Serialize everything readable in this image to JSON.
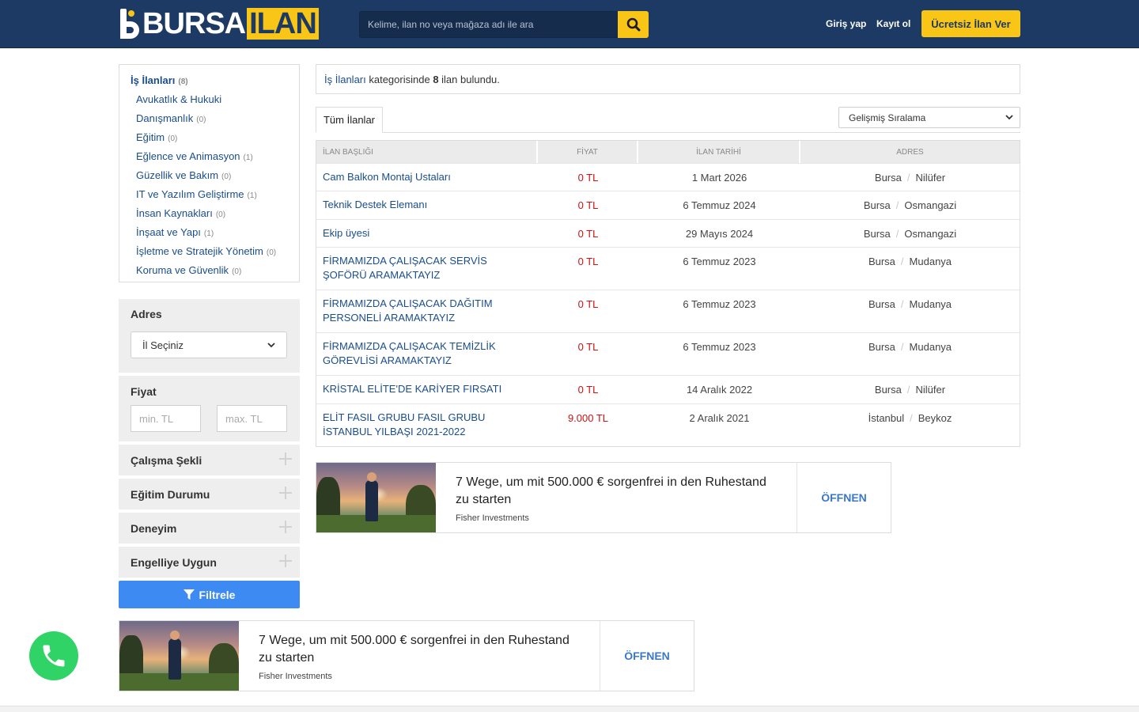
{
  "header": {
    "logo_left": "BURSA",
    "logo_right": "ILAN",
    "search_placeholder": "Kelime, ilan no veya mağaza adı ile ara",
    "login": "Giriş yap",
    "register": "Kayıt ol",
    "post_button": "Ücretsiz İlan Ver",
    "colors": {
      "navy": "#1c3a63",
      "accent": "#f9c517"
    }
  },
  "sidebar": {
    "root": {
      "label": "İş İlanları",
      "count": "(8)"
    },
    "categories": [
      {
        "label": "Avukatlık & Hukuki",
        "count": ""
      },
      {
        "label": "Danışmanlık",
        "count": "(0)"
      },
      {
        "label": "Eğitim",
        "count": "(0)"
      },
      {
        "label": "Eğlence ve Animasyon",
        "count": "(1)"
      },
      {
        "label": "Güzellik ve Bakım",
        "count": "(0)"
      },
      {
        "label": "IT ve Yazılım Geliştirme",
        "count": "(1)"
      },
      {
        "label": "İnsan Kaynakları",
        "count": "(0)"
      },
      {
        "label": "İnşaat ve Yapı",
        "count": "(1)"
      },
      {
        "label": "İşletme ve Stratejik Yönetim",
        "count": "(0)"
      },
      {
        "label": "Koruma ve Güvenlik",
        "count": "(0)"
      }
    ],
    "address": {
      "title": "Adres",
      "select_value": "İl Seçiniz"
    },
    "price": {
      "title": "Fiyat",
      "min_placeholder": "min. TL",
      "max_placeholder": "max. TL"
    },
    "collapsibles": [
      "Çalışma Şekli",
      "Eğitim Durumu",
      "Deneyim",
      "Engelliye Uygun"
    ],
    "filter_button": "Filtrele"
  },
  "main": {
    "result": {
      "category": "İş İlanları",
      "middle": " kategorisinde ",
      "count": "8",
      "suffix": " ilan bulundu."
    },
    "tab_all": "Tüm İlanlar",
    "sort_value": "Gelişmiş Sıralama",
    "table": {
      "headers": [
        "İLAN BAŞLIĞI",
        "FİYAT",
        "İLAN TARİHİ",
        "ADRES"
      ],
      "rows": [
        {
          "title": "Cam Balkon Montaj Ustaları",
          "price": "0 TL",
          "date": "1 Mart 2026",
          "city": "Bursa",
          "district": "Nilüfer"
        },
        {
          "title": "Teknik Destek Elemanı",
          "price": "0 TL",
          "date": "6 Temmuz 2024",
          "city": "Bursa",
          "district": "Osmangazi"
        },
        {
          "title": "Ekip üyesi",
          "price": "0 TL",
          "date": "29 Mayıs 2024",
          "city": "Bursa",
          "district": "Osmangazi"
        },
        {
          "title": "FİRMAMIZDA ÇALIŞACAK SERVİS ŞOFÖRÜ ARAMAKTAYIZ",
          "price": "0 TL",
          "date": "6 Temmuz 2023",
          "city": "Bursa",
          "district": "Mudanya"
        },
        {
          "title": "FİRMAMIZDA ÇALIŞACAK DAĞITIM PERSONELİ ARAMAKTAYIZ",
          "price": "0 TL",
          "date": "6 Temmuz 2023",
          "city": "Bursa",
          "district": "Mudanya"
        },
        {
          "title": "FİRMAMIZDA ÇALIŞACAK TEMİZLİK GÖREVLİSİ ARAMAKTAYIZ",
          "price": "0 TL",
          "date": "6 Temmuz 2023",
          "city": "Bursa",
          "district": "Mudanya"
        },
        {
          "title": "KRİSTAL ELİTE'DE KARİYER FIRSATI",
          "price": "0 TL",
          "date": "14 Aralık 2022",
          "city": "Bursa",
          "district": "Nilüfer"
        },
        {
          "title": "ELİT FASIL GRUBU FASIL GRUBU İSTANBUL YILBAŞI 2021-2022",
          "price": "9.000 TL",
          "date": "2 Aralık 2021",
          "city": "İstanbul",
          "district": "Beykoz"
        }
      ]
    }
  },
  "ads": [
    {
      "title": "7 Wege, um mit 500.000 € sorgenfrei in den Ruhestand zu starten",
      "source": "Fisher Investments",
      "cta": "ÖFFNEN"
    },
    {
      "title": "7 Wege, um mit 500.000 € sorgenfrei in den Ruhestand zu starten",
      "source": "Fisher Investments",
      "cta": "ÖFFNEN"
    }
  ]
}
